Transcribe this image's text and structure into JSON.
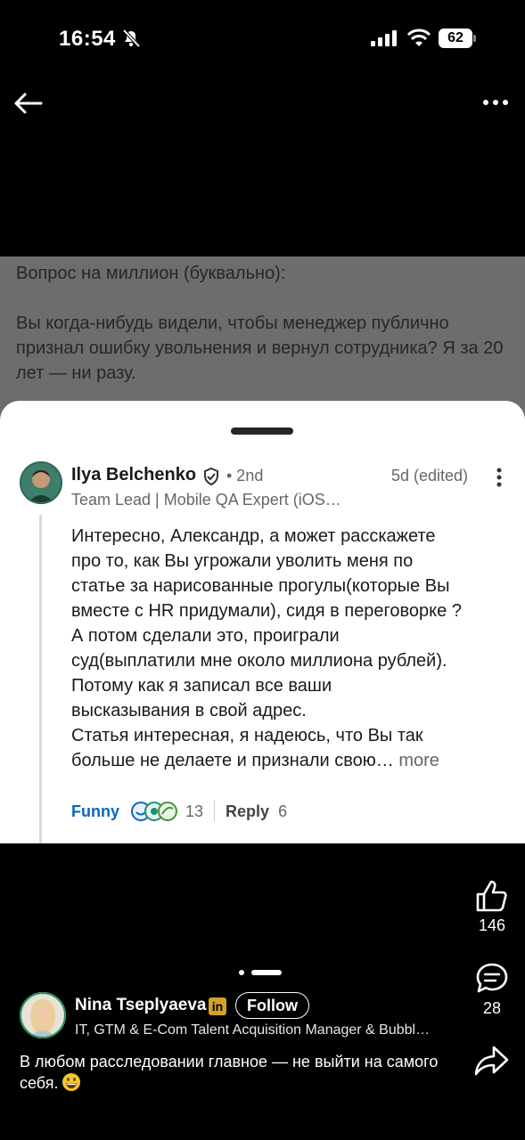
{
  "status_bar": {
    "time": "16:54",
    "battery": "62"
  },
  "post": {
    "paragraphs": [
      "Вопрос на миллион (буквально):",
      "Вы когда-нибудь видели, чтобы менеджер публично признал ошибку увольнения и вернул сотрудника? Я за 20 лет — ни разу."
    ]
  },
  "comment": {
    "author": "Ilya Belchenko",
    "degree": "• 2nd",
    "time": "5d (edited)",
    "headline": "Team Lead | Mobile QA Expert (iOS…",
    "lines": [
      "Интересно, Александр, а может расскажете",
      "про то, как Вы угрожали уволить меня по",
      "статье за нарисованные прогулы(которые Вы",
      "вместе с HR придумали), сидя в переговорке ?",
      "А потом сделали это, проиграли",
      "суд(выплатили мне около миллиона рублей).",
      "Потому как я записал все ваши",
      "высказывания в свой адрес.",
      "Статья интересная, я надеюсь, что Вы так",
      "больше не делаете и признали свою…"
    ],
    "more_label": "more",
    "reaction_label": "Funny",
    "reaction_count": "13",
    "reply_label": "Reply",
    "reply_count": "6"
  },
  "engagement": {
    "likes": "146",
    "comments": "28"
  },
  "author": {
    "name": "Nina Tseplyaeva",
    "badge": "in",
    "follow_label": "Follow",
    "headline": "IT, GTM & E-Com Talent Acquisition Manager & Bubbl…",
    "caption": "В любом расследовании главное — не выйти на самого себя."
  },
  "colors": {
    "link_blue": "#0a66c2",
    "dim_overlay": "#6d6d6d",
    "badge_gold": "#d4a02a"
  },
  "icons": [
    "mute-icon",
    "signal-icon",
    "wifi-icon",
    "back-arrow-icon",
    "more-icon",
    "verified-icon",
    "kebab-icon",
    "like-icon",
    "comment-icon",
    "share-icon",
    "grin-emoji-icon"
  ]
}
